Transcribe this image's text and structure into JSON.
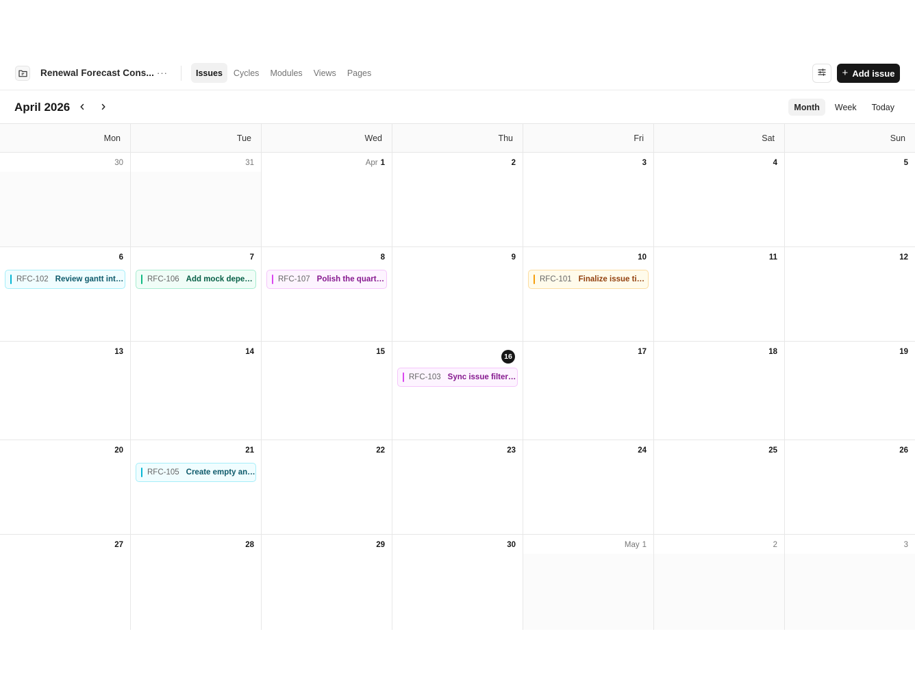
{
  "project": {
    "name": "Renewal Forecast Cons...",
    "more_label": "···"
  },
  "tabs": [
    {
      "label": "Issues",
      "active": true
    },
    {
      "label": "Cycles",
      "active": false
    },
    {
      "label": "Modules",
      "active": false
    },
    {
      "label": "Views",
      "active": false
    },
    {
      "label": "Pages",
      "active": false
    }
  ],
  "actions": {
    "add_issue_label": "Add issue"
  },
  "calendar": {
    "title": "April 2026",
    "views": [
      {
        "label": "Month",
        "active": true
      },
      {
        "label": "Week",
        "active": false
      },
      {
        "label": "Today",
        "active": false
      }
    ],
    "weekdays": [
      "Mon",
      "Tue",
      "Wed",
      "Thu",
      "Fri",
      "Sat",
      "Sun"
    ],
    "weeks": [
      [
        {
          "num": "30",
          "outside": true
        },
        {
          "num": "31",
          "outside": true
        },
        {
          "num": "1",
          "month_label": "Apr"
        },
        {
          "num": "2"
        },
        {
          "num": "3"
        },
        {
          "num": "4"
        },
        {
          "num": "5"
        }
      ],
      [
        {
          "num": "6",
          "issue": {
            "key": "RFC-102",
            "title": "Review gantt inter...",
            "color": "#06b6d4",
            "bg": "#f0fdff",
            "border": "#a5eef9",
            "text": "#0e5a6b"
          }
        },
        {
          "num": "7",
          "issue": {
            "key": "RFC-106",
            "title": "Add mock depen...",
            "color": "#10b981",
            "bg": "#f0fdf7",
            "border": "#a7ecd0",
            "text": "#065f46"
          }
        },
        {
          "num": "8",
          "issue": {
            "key": "RFC-107",
            "title": "Polish the quarter...",
            "color": "#d946ef",
            "bg": "#fdf4ff",
            "border": "#f5c6fb",
            "text": "#86198f"
          }
        },
        {
          "num": "9"
        },
        {
          "num": "10",
          "issue": {
            "key": "RFC-101",
            "title": "Finalize issue time...",
            "color": "#f59e0b",
            "bg": "#fffbeb",
            "border": "#fcdca0",
            "text": "#92400e"
          }
        },
        {
          "num": "11"
        },
        {
          "num": "12"
        }
      ],
      [
        {
          "num": "13"
        },
        {
          "num": "14"
        },
        {
          "num": "15"
        },
        {
          "num": "16",
          "today": true,
          "issue": {
            "key": "RFC-103",
            "title": "Sync issue filters ...",
            "color": "#d946ef",
            "bg": "#fdf4ff",
            "border": "#f5c6fb",
            "text": "#86198f"
          }
        },
        {
          "num": "17"
        },
        {
          "num": "18"
        },
        {
          "num": "19"
        }
      ],
      [
        {
          "num": "20"
        },
        {
          "num": "21",
          "issue": {
            "key": "RFC-105",
            "title": "Create empty and...",
            "color": "#06b6d4",
            "bg": "#f0fdff",
            "border": "#a5eef9",
            "text": "#0e5a6b"
          }
        },
        {
          "num": "22"
        },
        {
          "num": "23"
        },
        {
          "num": "24"
        },
        {
          "num": "25"
        },
        {
          "num": "26"
        }
      ],
      [
        {
          "num": "27"
        },
        {
          "num": "28"
        },
        {
          "num": "29"
        },
        {
          "num": "30"
        },
        {
          "num": "1",
          "month_label": "May",
          "outside": true
        },
        {
          "num": "2",
          "outside": true
        },
        {
          "num": "3",
          "outside": true
        }
      ]
    ]
  }
}
